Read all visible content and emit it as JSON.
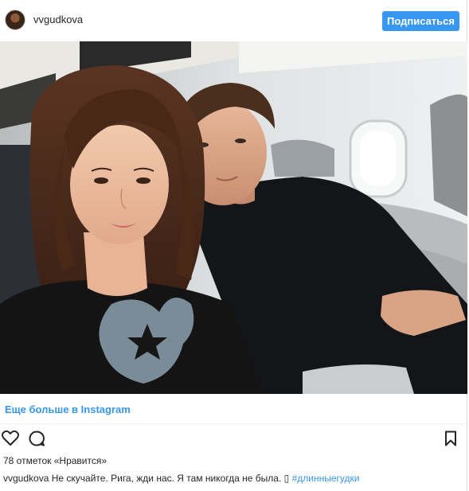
{
  "header": {
    "username": "vvgudkova",
    "subscribe_label": "Подписаться"
  },
  "photo": {
    "description_icon": "photo-image"
  },
  "more_link": "Еще больше в Instagram",
  "actions": {
    "like_icon": "heart-icon",
    "comment_icon": "comment-icon",
    "bookmark_icon": "bookmark-icon"
  },
  "likes_text": "78 отметок «Нравится»",
  "caption": {
    "username": "vvgudkova",
    "text": "Не скучайте. Рига, жди нас. Я там никогда не была. ",
    "emoji": "▯",
    "hashtag": "#длинныегудки"
  },
  "colors": {
    "accent": "#3897f0",
    "text": "#262626",
    "divider": "#efefef"
  }
}
